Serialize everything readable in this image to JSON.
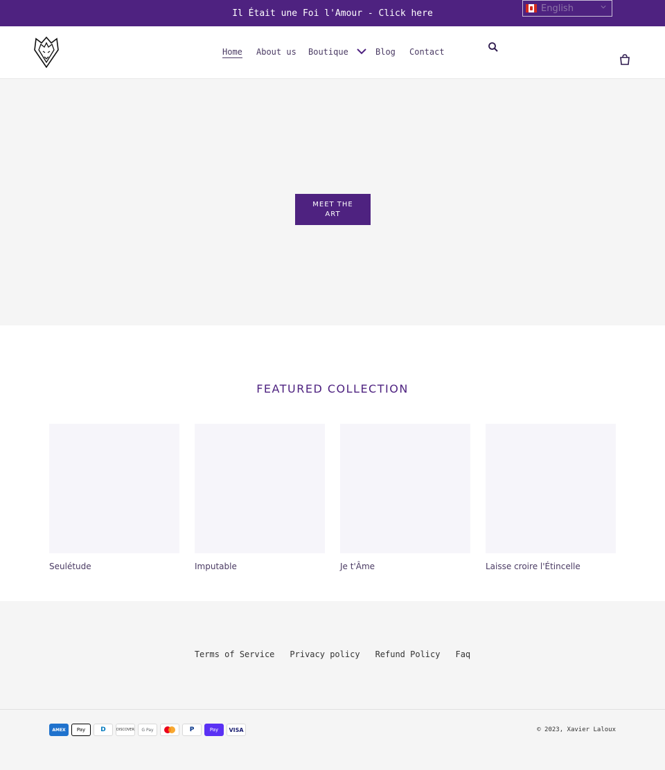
{
  "announcement": {
    "text": "Il Était une Foi l'Amour - Click here"
  },
  "language": {
    "selected": "English",
    "flag": "canada-flag-icon"
  },
  "nav": {
    "home": "Home",
    "about": "About us",
    "boutique": "Boutique",
    "blog": "Blog",
    "contact": "Contact"
  },
  "icons": {
    "search": "search-icon",
    "cart": "cart-icon",
    "logo": "wolf-logo"
  },
  "hero": {
    "button": "MEET THE ART"
  },
  "featured": {
    "title": "FEATURED COLLECTION",
    "products": [
      {
        "title": "Seulétude"
      },
      {
        "title": "Imputable"
      },
      {
        "title": "Je t'Âme"
      },
      {
        "title": "Laisse croire l'Étincelle"
      }
    ]
  },
  "footer": {
    "links": [
      "Terms of Service",
      "Privacy policy",
      "Refund Policy",
      "Faq"
    ],
    "payments": [
      "AMEX",
      "Pay",
      "D",
      "DISCOVER",
      "G Pay",
      "mastercard",
      "P",
      "Pay",
      "VISA"
    ],
    "copyright": "© 2023, Xavier Laloux"
  },
  "colors": {
    "brand": "#4e2280",
    "hero_bg": "#f5f5f5",
    "footer_bg": "#f5f5f5"
  }
}
